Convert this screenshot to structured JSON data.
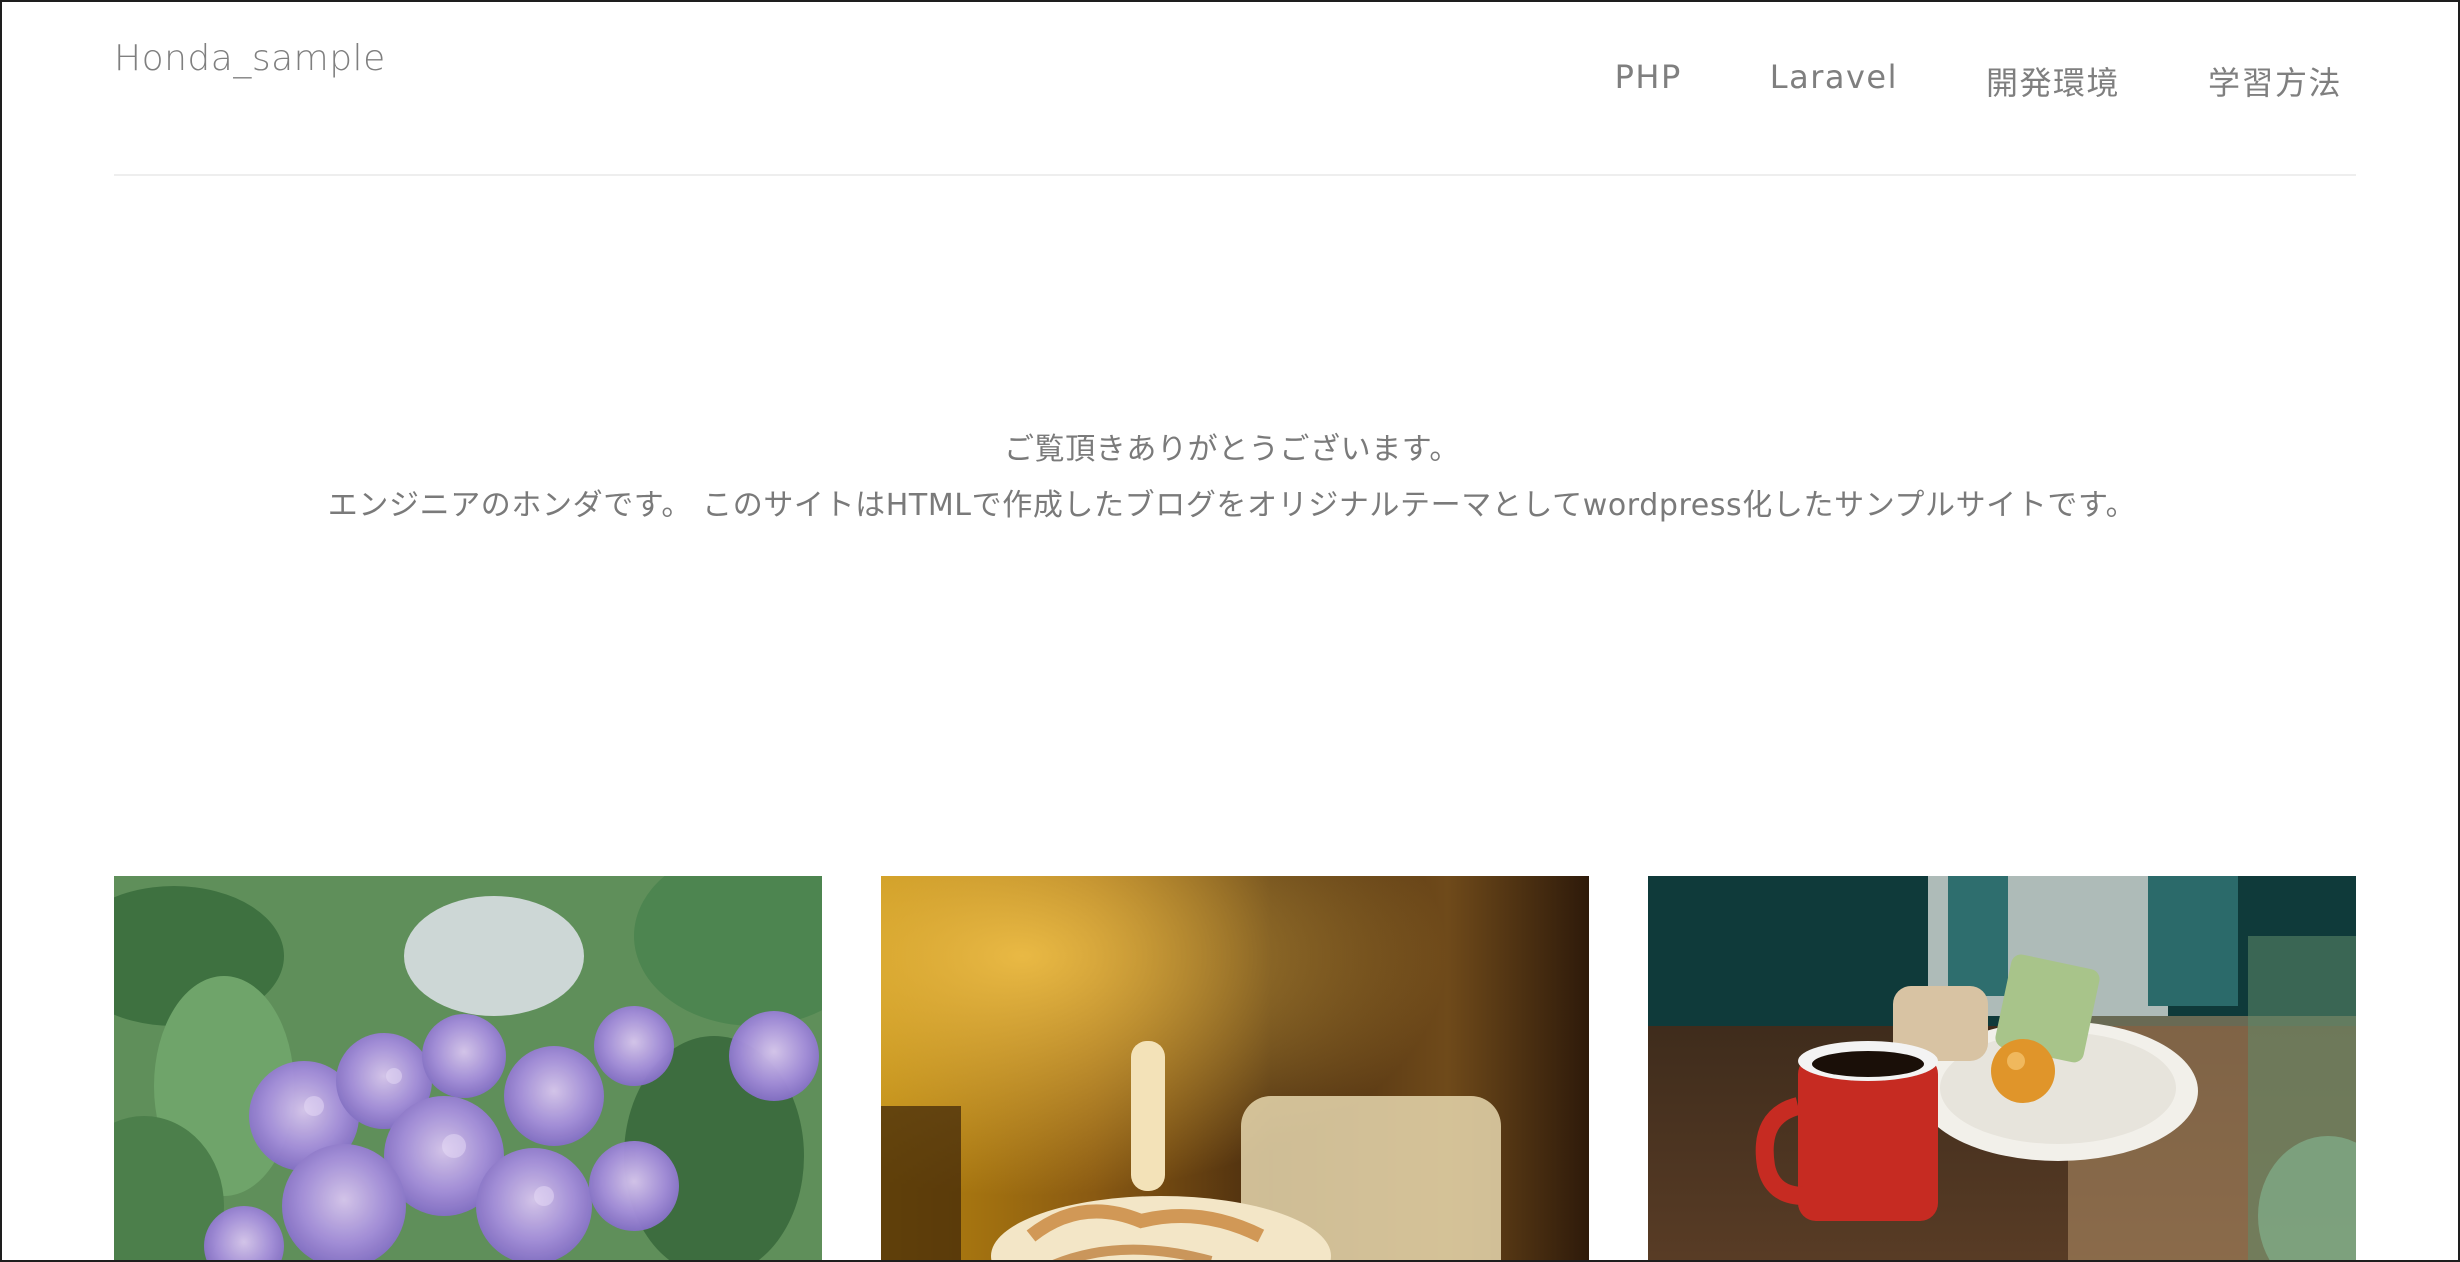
{
  "header": {
    "site_title": "Honda_sample"
  },
  "nav": {
    "items": [
      {
        "label": "PHP"
      },
      {
        "label": "Laravel"
      },
      {
        "label": "開発環境"
      },
      {
        "label": "学習方法"
      }
    ]
  },
  "intro": {
    "line1": "ご覧頂きありがとうございます。",
    "line2": "エンジニアのホンダです。 このサイトはHTMLで作成したブログをオリジナルテーマとしてwordpress化したサンプルサイトです。"
  },
  "cards": [
    {
      "image": "hydrangea-flowers-photo"
    },
    {
      "image": "latte-drink-photo"
    },
    {
      "image": "coffee-mug-and-sweets-photo"
    }
  ]
}
